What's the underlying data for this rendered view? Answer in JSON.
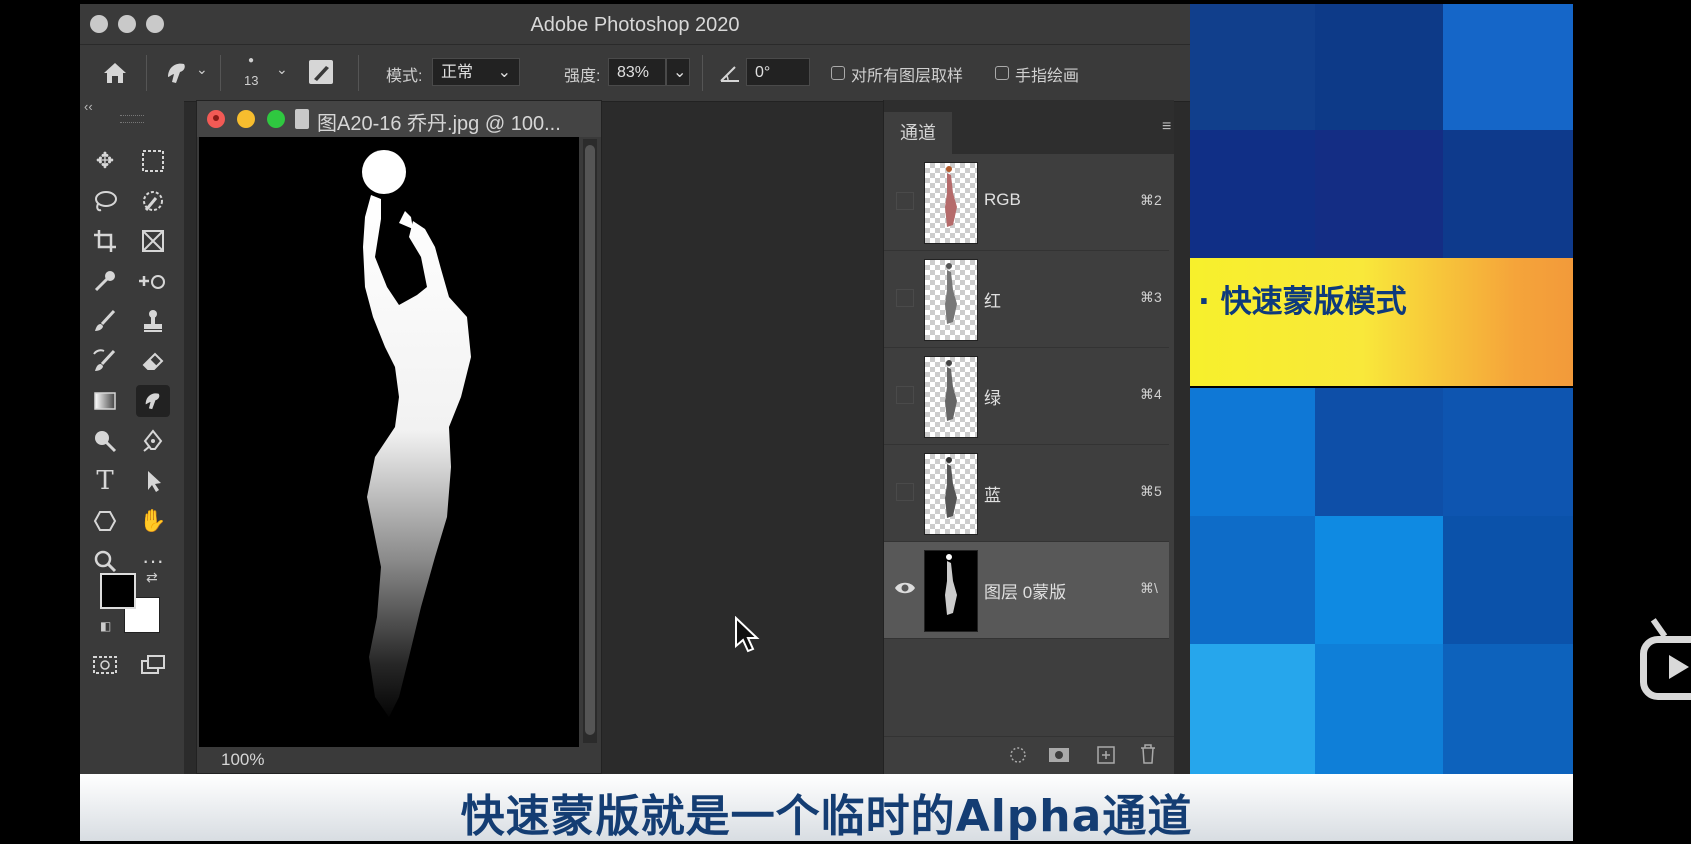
{
  "app": {
    "title": "Adobe Photoshop 2020"
  },
  "options": {
    "brush_size": "13",
    "mode_label": "模式:",
    "mode_value": "正常",
    "strength_label": "强度:",
    "strength_value": "83%",
    "angle_value": "0°",
    "sample_all_label": "对所有图层取样",
    "finger_paint_label": "手指绘画"
  },
  "document": {
    "tab_title": "图A20-16 乔丹.jpg @ 100...",
    "zoom": "100%"
  },
  "channels": {
    "tab": "通道",
    "rows": [
      {
        "name": "RGB",
        "shortcut": "⌘2",
        "visible": false
      },
      {
        "name": "红",
        "shortcut": "⌘3",
        "visible": false
      },
      {
        "name": "绿",
        "shortcut": "⌘4",
        "visible": false
      },
      {
        "name": "蓝",
        "shortcut": "⌘5",
        "visible": false
      },
      {
        "name": "图层 0蒙版",
        "shortcut": "⌘\\",
        "visible": true
      }
    ]
  },
  "slide": {
    "banner": "· 快速蒙版模式"
  },
  "subtitle": "快速蒙版就是一个临时的Alpha通道",
  "colors": {
    "accent_blue": "#143d73",
    "banner_yellow": "#f7f02c",
    "panel_bg": "#3e3e3e"
  }
}
